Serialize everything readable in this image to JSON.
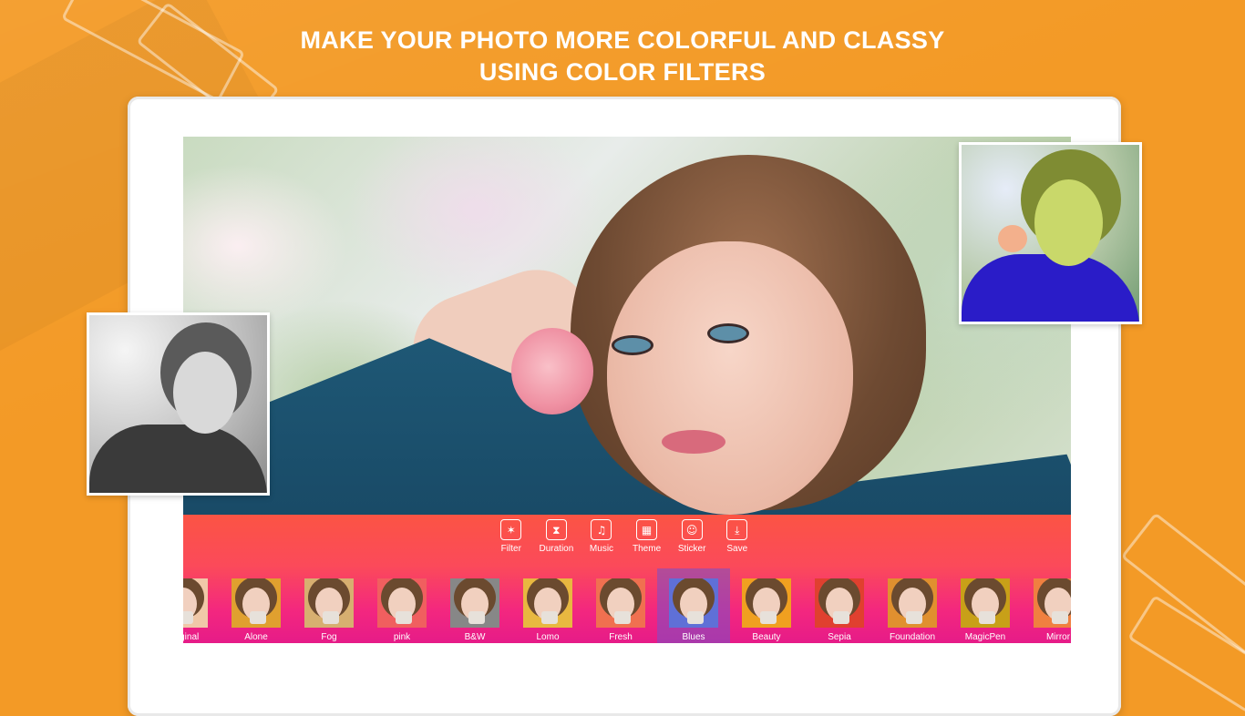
{
  "headline": {
    "line1": "MAKE YOUR PHOTO MORE COLORFUL AND CLASSY",
    "line2": "USING COLOR FILTERS"
  },
  "toolbar": {
    "tools": [
      {
        "label": "Filter",
        "icon": "magic-wand-icon",
        "glyph": "✶"
      },
      {
        "label": "Duration",
        "icon": "hourglass-icon",
        "glyph": "⧗"
      },
      {
        "label": "Music",
        "icon": "music-note-icon",
        "glyph": "♫"
      },
      {
        "label": "Theme",
        "icon": "theme-icon",
        "glyph": "▦"
      },
      {
        "label": "Sticker",
        "icon": "sticker-icon",
        "glyph": "☺"
      },
      {
        "label": "Save",
        "icon": "download-icon",
        "glyph": "⤓"
      }
    ]
  },
  "filters": {
    "selected": "Blues",
    "items": [
      {
        "label": "Original",
        "tint": "#f0c8a8"
      },
      {
        "label": "Alone",
        "tint": "#e0a030"
      },
      {
        "label": "Fog",
        "tint": "#d8b070"
      },
      {
        "label": "pink",
        "tint": "#f06060"
      },
      {
        "label": "B&W",
        "tint": "#888888"
      },
      {
        "label": "Lomo",
        "tint": "#e8b840"
      },
      {
        "label": "Fresh",
        "tint": "#f07050"
      },
      {
        "label": "Blues",
        "tint": "#6070d8"
      },
      {
        "label": "Beauty",
        "tint": "#f0a020"
      },
      {
        "label": "Sepia",
        "tint": "#e04030"
      },
      {
        "label": "Foundation",
        "tint": "#e09030"
      },
      {
        "label": "MagicPen",
        "tint": "#c8a018"
      },
      {
        "label": "Mirror",
        "tint": "#f08040"
      }
    ]
  },
  "colors": {
    "background": "#f39a26",
    "toolbar_top": "#fb5444",
    "toolbar_bottom": "#e61b88",
    "selected_filter": "#7850c8"
  }
}
